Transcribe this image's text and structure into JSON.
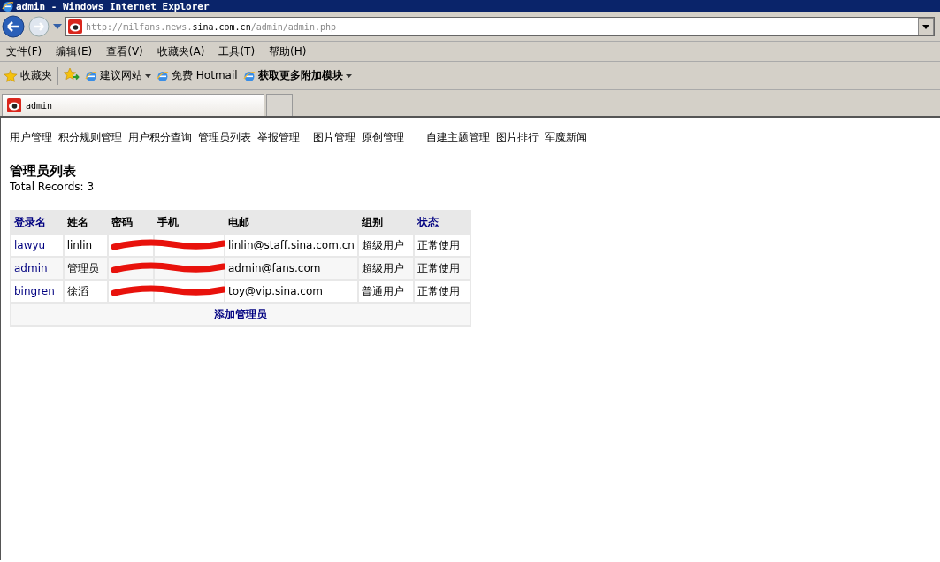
{
  "window": {
    "title": "admin - Windows Internet Explorer"
  },
  "address_bar": {
    "url_parts": [
      {
        "text": "http://milfans.news.",
        "emphasis": false
      },
      {
        "text": "sina.com.cn",
        "emphasis": true
      },
      {
        "text": "/admin/admin.php",
        "emphasis": false
      }
    ]
  },
  "menu": [
    "文件(F)",
    "编辑(E)",
    "查看(V)",
    "收藏夹(A)",
    "工具(T)",
    "帮助(H)"
  ],
  "favorites_bar": {
    "label": "收藏夹",
    "items": [
      {
        "label": "建议网站",
        "dropdown": true,
        "emphasis": false
      },
      {
        "label": "免费 Hotmail",
        "dropdown": false,
        "emphasis": false
      },
      {
        "label": "获取更多附加模块",
        "dropdown": true,
        "emphasis": true
      }
    ]
  },
  "tabs": [
    {
      "label": "admin",
      "selected": true
    }
  ],
  "page": {
    "nav_links": [
      "用户管理",
      "积分规则管理",
      "用户积分查询",
      "管理员列表",
      "举报管理",
      "图片管理",
      "原创管理",
      "自建主题管理",
      "图片排行",
      "军魔新闻"
    ],
    "heading": "管理员列表",
    "total": "Total Records:  3",
    "table": {
      "columns": [
        {
          "label": "登录名",
          "sortable": true
        },
        {
          "label": "姓名",
          "sortable": false
        },
        {
          "label": "密码",
          "sortable": false
        },
        {
          "label": "手机",
          "sortable": false
        },
        {
          "label": "电邮",
          "sortable": false
        },
        {
          "label": "组别",
          "sortable": false
        },
        {
          "label": "状态",
          "sortable": true
        }
      ],
      "rows": [
        {
          "login": "lawyu",
          "name": "linlin",
          "email": "linlin@staff.sina.com.cn",
          "group": "超级用户",
          "status": "正常使用",
          "redacted": true
        },
        {
          "login": "admin",
          "name": "管理员",
          "email": "admin@fans.com",
          "group": "超级用户",
          "status": "正常使用",
          "redacted": true
        },
        {
          "login": "bingren",
          "name": "徐滔",
          "email": "toy@vip.sina.com",
          "group": "普通用户",
          "status": "正常使用",
          "redacted": true
        }
      ],
      "add_action": "添加管理员"
    }
  }
}
